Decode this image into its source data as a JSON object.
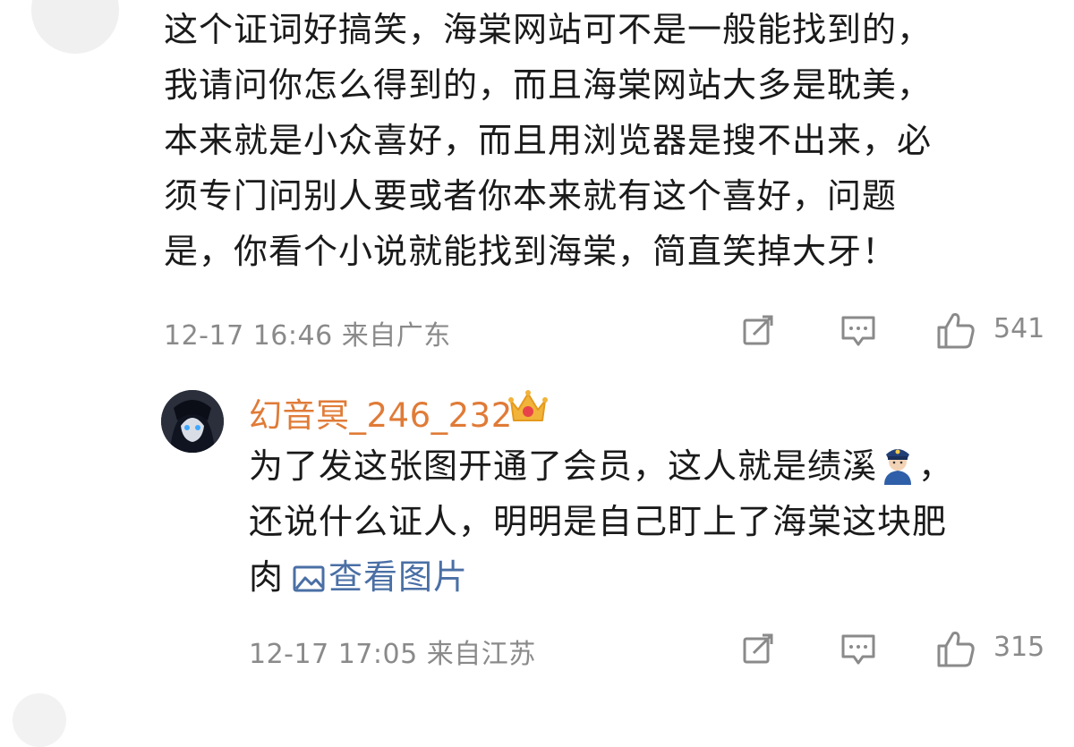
{
  "comment": {
    "lines": [
      "这个证词好搞笑，海棠网站可不是一般能找到的，",
      "我请问你怎么得到的，而且海棠网站大多是耽美，",
      "本来就是小众喜好，而且用浏览器是搜不出来，必",
      "须专门问别人要或者你本来就有这个喜好，问题",
      "是，你看个小说就能找到海棠，简直笑掉大牙！"
    ],
    "meta": "12-17 16:46  来自广东",
    "like_count": "541"
  },
  "reply": {
    "username": "幻音冥_246_232",
    "line1_before_emoji": "为了发这张图开通了会员，这人就是绩溪",
    "line1_after_emoji": "，",
    "line2": "还说什么证人，明明是自己盯上了海棠这块肥",
    "line3": "肉",
    "view_image_label": "查看图片",
    "meta": "12-17 17:05  来自江苏",
    "like_count": "315"
  },
  "colors": {
    "username": "#e07b37",
    "link": "#4a6fa5",
    "meta": "#8a8a8a"
  },
  "icons": [
    "share-icon",
    "comment-icon",
    "like-icon",
    "vip-crown-icon",
    "police-emoji-icon",
    "image-icon"
  ]
}
